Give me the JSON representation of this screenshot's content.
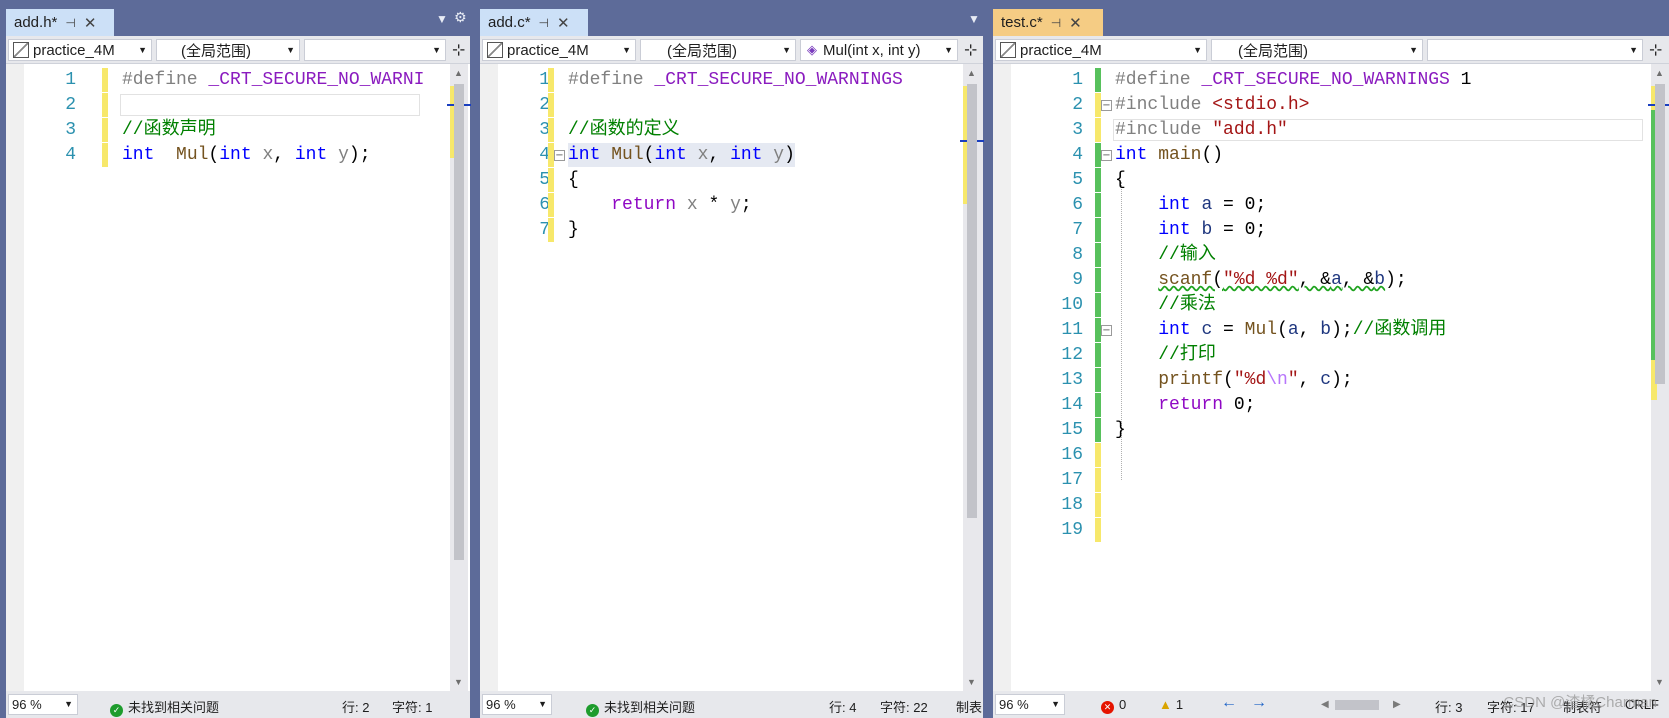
{
  "panes": [
    {
      "tab": {
        "title": "add.h*",
        "pin": "⊣",
        "close": "✕",
        "active": false
      },
      "nav": {
        "project": "practice_4M",
        "scope": "(全局范围)",
        "member": ""
      },
      "lines": [
        {
          "n": "1",
          "tokens": [
            [
              "pp",
              "#define "
            ],
            [
              "mac",
              "_CRT_SECURE_NO_WARNI"
            ]
          ]
        },
        {
          "n": "2",
          "tokens": []
        },
        {
          "n": "3",
          "tokens": [
            [
              "cm",
              "//函数声明"
            ]
          ]
        },
        {
          "n": "4",
          "tokens": [
            [
              "kw",
              "int"
            ],
            [
              "",
              "  "
            ],
            [
              "fn",
              "Mul"
            ],
            [
              "",
              "("
            ],
            [
              "kw",
              "int"
            ],
            [
              "",
              " "
            ],
            [
              "pr",
              "x"
            ],
            [
              "",
              ", "
            ],
            [
              "kw",
              "int"
            ],
            [
              "",
              " "
            ],
            [
              "pr",
              "y"
            ],
            [
              "",
              ");"
            ]
          ]
        }
      ],
      "status": {
        "zoom": "96 %",
        "issues": "未找到相关问题",
        "line": "行: 2",
        "col": "字符: 1"
      }
    },
    {
      "tab": {
        "title": "add.c*",
        "pin": "⊣",
        "close": "✕",
        "active": false
      },
      "nav": {
        "project": "practice_4M",
        "scope": "(全局范围)",
        "member": "Mul(int x, int y)"
      },
      "lines": [
        {
          "n": "1",
          "tokens": [
            [
              "pp",
              "#define "
            ],
            [
              "mac",
              "_CRT_SECURE_NO_WARNINGS"
            ]
          ]
        },
        {
          "n": "2",
          "tokens": []
        },
        {
          "n": "3",
          "tokens": [
            [
              "cm",
              "//函数的定义"
            ]
          ]
        },
        {
          "n": "4",
          "tokens": [
            [
              "kw",
              "int"
            ],
            [
              "",
              " "
            ],
            [
              "fn",
              "Mul"
            ],
            [
              "",
              "("
            ],
            [
              "kw",
              "int"
            ],
            [
              "",
              " "
            ],
            [
              "pr",
              "x"
            ],
            [
              "",
              ", "
            ],
            [
              "kw",
              "int"
            ],
            [
              "",
              " "
            ],
            [
              "pr",
              "y"
            ],
            [
              "",
              ")"
            ]
          ]
        },
        {
          "n": "5",
          "tokens": [
            [
              "",
              "{"
            ]
          ]
        },
        {
          "n": "6",
          "tokens": [
            [
              "",
              "    "
            ],
            [
              "ret",
              "return"
            ],
            [
              "",
              " "
            ],
            [
              "pr",
              "x"
            ],
            [
              "",
              " * "
            ],
            [
              "pr",
              "y"
            ],
            [
              "",
              ";"
            ]
          ]
        },
        {
          "n": "7",
          "tokens": [
            [
              "",
              "}"
            ]
          ]
        }
      ],
      "status": {
        "zoom": "96 %",
        "issues": "未找到相关问题",
        "line": "行: 4",
        "col": "字符: 22",
        "extra": "制表"
      }
    },
    {
      "tab": {
        "title": "test.c*",
        "pin": "⊣",
        "close": "✕",
        "active": true
      },
      "nav": {
        "project": "practice_4M",
        "scope": "(全局范围)",
        "member": ""
      },
      "lines": [
        {
          "n": "1",
          "tokens": [
            [
              "pp",
              "#define "
            ],
            [
              "mac",
              "_CRT_SECURE_NO_WARNINGS"
            ],
            [
              "",
              " 1"
            ]
          ]
        },
        {
          "n": "2",
          "tokens": [
            [
              "pp",
              "#include "
            ],
            [
              "inc",
              "<stdio.h>"
            ]
          ]
        },
        {
          "n": "3",
          "tokens": [
            [
              "pp",
              "#include "
            ],
            [
              "inc",
              "\"add.h\""
            ]
          ]
        },
        {
          "n": "4",
          "tokens": [
            [
              "kw",
              "int"
            ],
            [
              "",
              " "
            ],
            [
              "fn",
              "main"
            ],
            [
              "",
              "()"
            ]
          ]
        },
        {
          "n": "5",
          "tokens": [
            [
              "",
              "{"
            ]
          ]
        },
        {
          "n": "6",
          "tokens": [
            [
              "",
              "    "
            ],
            [
              "kw",
              "int"
            ],
            [
              "",
              " "
            ],
            [
              "lv",
              "a"
            ],
            [
              "",
              " = "
            ],
            [
              "",
              "0"
            ],
            [
              "",
              ";"
            ]
          ]
        },
        {
          "n": "7",
          "tokens": [
            [
              "",
              "    "
            ],
            [
              "kw",
              "int"
            ],
            [
              "",
              " "
            ],
            [
              "lv",
              "b"
            ],
            [
              "",
              " = "
            ],
            [
              "",
              "0"
            ],
            [
              "",
              ";"
            ]
          ]
        },
        {
          "n": "8",
          "tokens": [
            [
              "",
              "    "
            ],
            [
              "cm",
              "//输入"
            ]
          ]
        },
        {
          "n": "9",
          "tokens": [
            [
              "",
              "    "
            ],
            [
              "fn squig",
              "scanf"
            ],
            [
              "squig",
              "("
            ],
            [
              "st squig",
              "\"%d %d\""
            ],
            [
              "squig",
              ", &"
            ],
            [
              "lv squig",
              "a"
            ],
            [
              "squig",
              ", &"
            ],
            [
              "lv squig",
              "b"
            ],
            [
              "",
              ");"
            ]
          ]
        },
        {
          "n": "10",
          "tokens": [
            [
              "",
              "    "
            ],
            [
              "cm",
              "//乘法"
            ]
          ]
        },
        {
          "n": "11",
          "tokens": [
            [
              "",
              "    "
            ],
            [
              "kw",
              "int"
            ],
            [
              "",
              " "
            ],
            [
              "lv",
              "c"
            ],
            [
              "",
              " = "
            ],
            [
              "fn",
              "Mul"
            ],
            [
              "",
              "("
            ],
            [
              "lv",
              "a"
            ],
            [
              "",
              ", "
            ],
            [
              "lv",
              "b"
            ],
            [
              "",
              ");"
            ],
            [
              "cm",
              "//函数调用"
            ]
          ]
        },
        {
          "n": "12",
          "tokens": [
            [
              "",
              "    "
            ],
            [
              "cm",
              "//打印"
            ]
          ]
        },
        {
          "n": "13",
          "tokens": [
            [
              "",
              "    "
            ],
            [
              "fn",
              "printf"
            ],
            [
              "",
              "("
            ],
            [
              "st",
              "\"%d"
            ],
            [
              "esc",
              "\\n"
            ],
            [
              "st",
              "\""
            ],
            [
              "",
              ", "
            ],
            [
              "lv",
              "c"
            ],
            [
              "",
              ");"
            ]
          ]
        },
        {
          "n": "14",
          "tokens": [
            [
              "",
              "    "
            ],
            [
              "ret",
              "return"
            ],
            [
              "",
              " "
            ],
            [
              "",
              "0"
            ],
            [
              "",
              ";"
            ]
          ]
        },
        {
          "n": "15",
          "tokens": [
            [
              "",
              "}"
            ]
          ]
        },
        {
          "n": "16",
          "tokens": []
        },
        {
          "n": "17",
          "tokens": []
        },
        {
          "n": "18",
          "tokens": []
        },
        {
          "n": "19",
          "tokens": []
        }
      ],
      "status": {
        "zoom": "96 %",
        "errors": "0",
        "warnings": "1",
        "line": "行: 3",
        "col": "字符: 17",
        "tab_mode": "制表符",
        "eol": "CRLF"
      }
    }
  ],
  "watermark": "CSDN @渣橘Charman",
  "colors": {
    "frame": "#5d6b99",
    "tab_inactive": "#cce0f7",
    "tab_active": "#f5cc84",
    "changed_unsaved": "#f7e86b",
    "changed_saved": "#57c15c"
  }
}
